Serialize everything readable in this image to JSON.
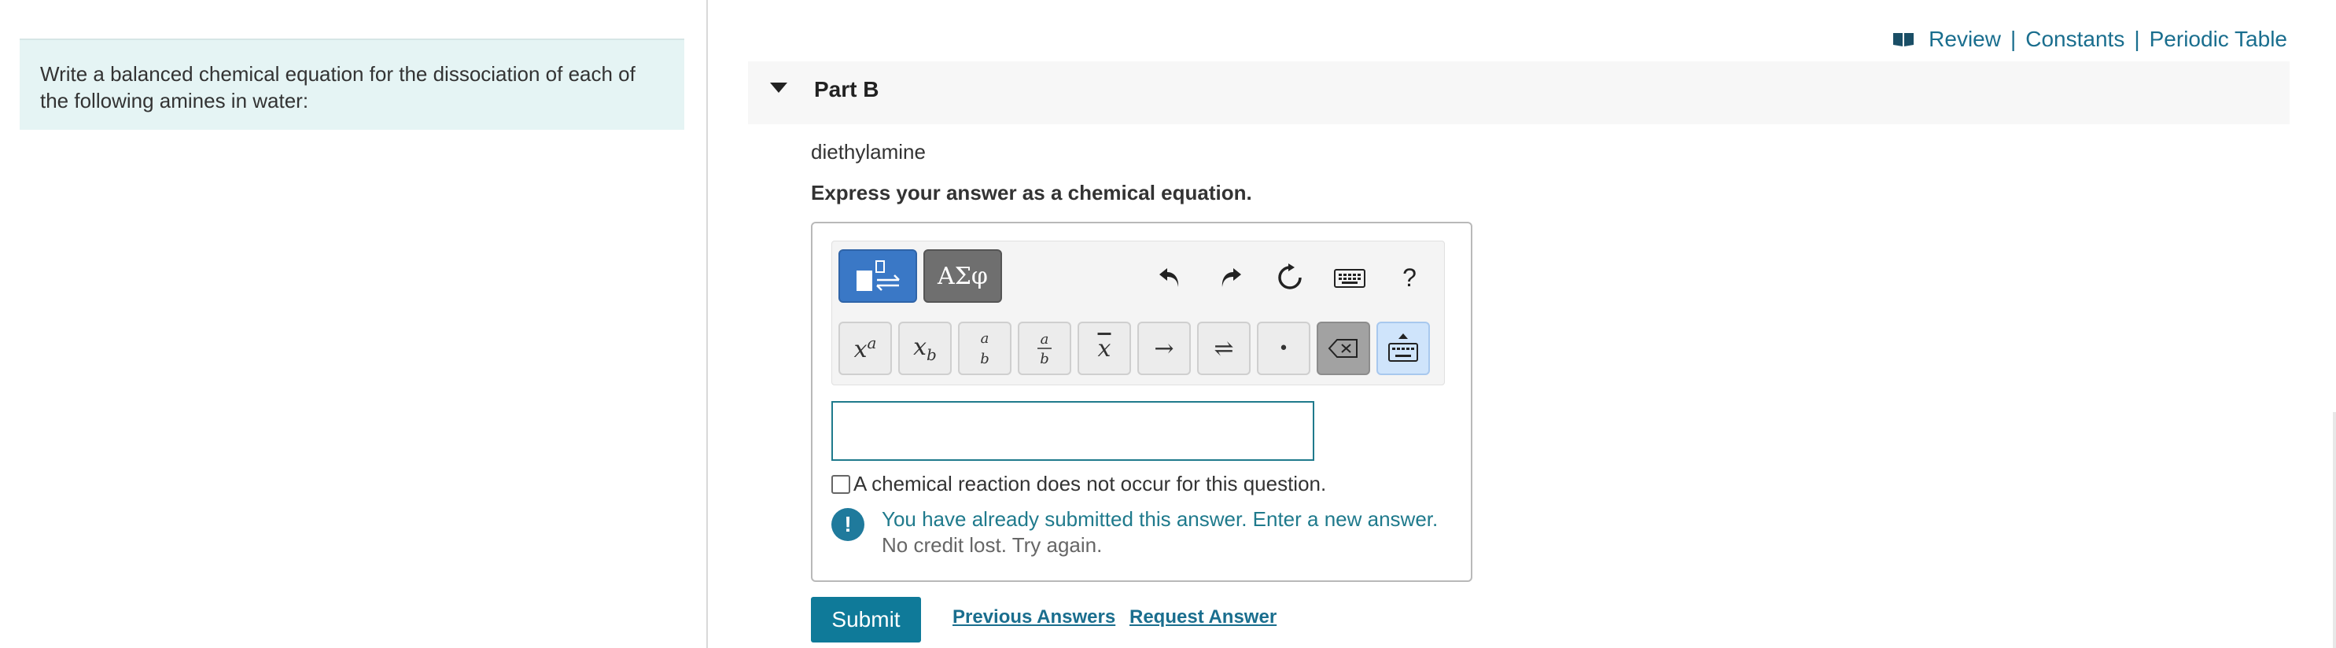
{
  "prompt": {
    "text": "Write a balanced chemical equation for the dissociation of each of the following amines in water:"
  },
  "top_links": {
    "review": "Review",
    "sep1": "|",
    "constants": "Constants",
    "sep2": "|",
    "periodic_table": "Periodic Table"
  },
  "part": {
    "title": "Part B",
    "question": "diethylamine",
    "instruction": "Express your answer as a chemical equation."
  },
  "toolbar": {
    "greek_label": "ΑΣφ",
    "help_label": "?",
    "keys": {
      "arrow": "→",
      "equilibrium": "⇌",
      "dot": "•"
    }
  },
  "input": {
    "value": ""
  },
  "no_reaction_label": "A chemical reaction does not occur for this question.",
  "feedback": {
    "icon": "!",
    "message": "You have already submitted this answer. Enter a new answer.",
    "sub": "No credit lost. Try again."
  },
  "actions": {
    "submit": "Submit",
    "previous_answers": "Previous Answers",
    "request_answer": "Request Answer"
  },
  "colors": {
    "accent": "#0f7a99",
    "prompt_bg": "#e5f4f4",
    "link": "#1a6e8e"
  }
}
